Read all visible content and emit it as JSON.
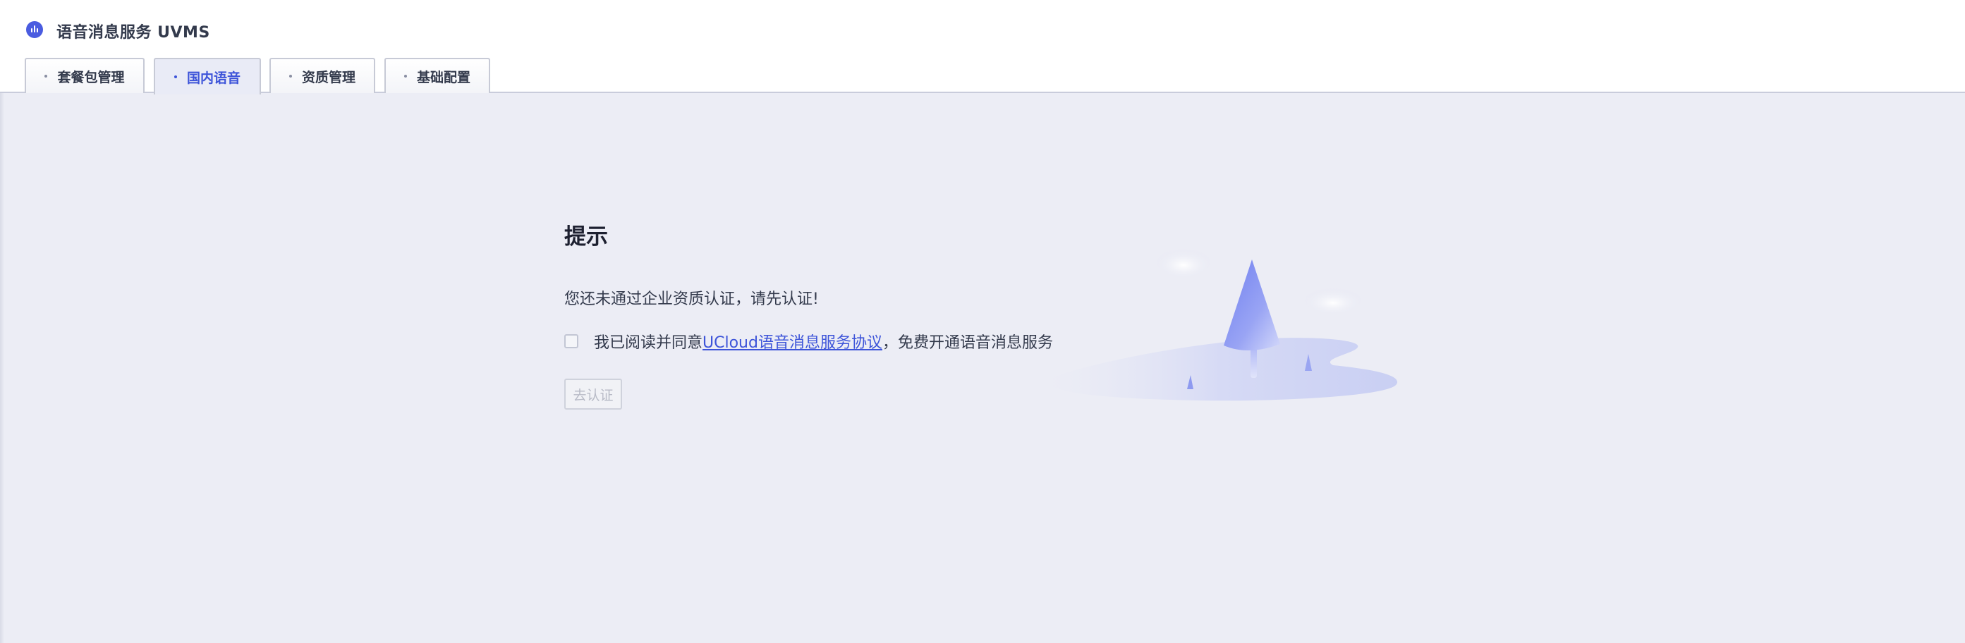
{
  "header": {
    "service_title": "语音消息服务 UVMS",
    "logo_icon": "voice-wave-icon",
    "accent_color": "#3d54d9"
  },
  "tabs": [
    {
      "label": "套餐包管理",
      "active": false
    },
    {
      "label": "国内语音",
      "active": true
    },
    {
      "label": "资质管理",
      "active": false
    },
    {
      "label": "基础配置",
      "active": false
    }
  ],
  "main": {
    "tip_title": "提示",
    "tip_message": "您还未通过企业资质认证，请先认证!",
    "agreement": {
      "checked": false,
      "prefix": "我已阅读并同意",
      "link_text": "UCloud语音消息服务协议",
      "suffix": "，免费开通语音消息服务"
    },
    "verify_button_label": "去认证",
    "verify_button_disabled": true,
    "illustration": "tree-island-illustration"
  }
}
